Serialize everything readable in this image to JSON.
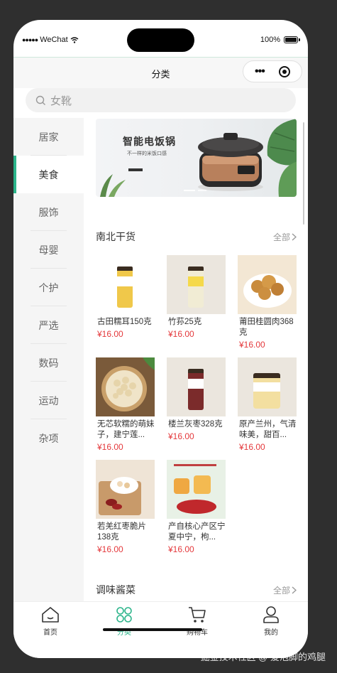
{
  "status_bar": {
    "carrier": "WeChat",
    "battery_text": "100%"
  },
  "nav": {
    "title": "分类"
  },
  "search": {
    "placeholder": "女靴"
  },
  "sidebar": {
    "items": [
      {
        "label": "居家"
      },
      {
        "label": "美食"
      },
      {
        "label": "服饰"
      },
      {
        "label": "母婴"
      },
      {
        "label": "个护"
      },
      {
        "label": "严选"
      },
      {
        "label": "数码"
      },
      {
        "label": "运动"
      },
      {
        "label": "杂项"
      }
    ],
    "active_index": 1
  },
  "banner": {
    "title": "智能电饭锅",
    "subtitle": "不一样的米饭口感"
  },
  "sections": [
    {
      "title": "南北干货",
      "more": "全部",
      "products": [
        {
          "name": "古田糯耳150克",
          "price": "¥16.00"
        },
        {
          "name": "竹荪25克",
          "price": "¥16.00"
        },
        {
          "name": "莆田桂圆肉368克",
          "price": "¥16.00"
        },
        {
          "name": "无芯软糯的萌妹子，建宁莲...",
          "price": "¥16.00"
        },
        {
          "name": "楼兰灰枣328克",
          "price": "¥16.00"
        },
        {
          "name": "原产兰州，气清味美，甜百...",
          "price": "¥16.00"
        },
        {
          "name": "若羌红枣脆片138克",
          "price": "¥16.00"
        },
        {
          "name": "产自核心产区宁夏中宁，枸...",
          "price": "¥16.00"
        }
      ]
    },
    {
      "title": "调味酱菜",
      "more": "全部"
    }
  ],
  "tabbar": {
    "items": [
      {
        "label": "首页"
      },
      {
        "label": "分类"
      },
      {
        "label": "购物车"
      },
      {
        "label": "我的"
      }
    ],
    "active_index": 1
  },
  "watermark": "掘金技术社区 @ 爱泡脚的鸡腿",
  "colors": {
    "accent": "#2bb48a",
    "price": "#e4393c",
    "sidebar_bg": "#f5f5f5"
  }
}
